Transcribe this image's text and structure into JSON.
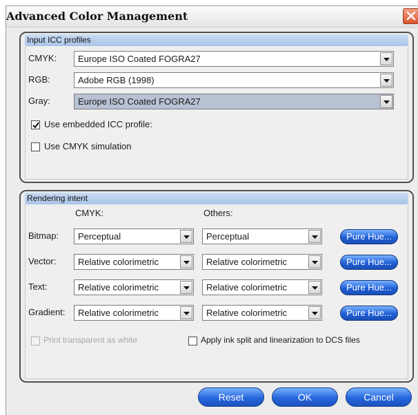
{
  "dialog": {
    "title": "Advanced Color Management"
  },
  "icons": {
    "close": "close-icon",
    "dropdown": "chevron-down-icon",
    "check": "checkmark-icon"
  },
  "colors": {
    "header_accent": "#b3cbeb",
    "button_blue": "#2566dc",
    "close_red": "#d9552f"
  },
  "input_profiles": {
    "header": "Input ICC profiles",
    "cmyk_label": "CMYK:",
    "cmyk_value": "Europe ISO Coated FOGRA27",
    "rgb_label": "RGB:",
    "rgb_value": "Adobe RGB (1998)",
    "gray_label": "Gray:",
    "gray_value": "Europe ISO Coated FOGRA27",
    "embedded_label": "Use embedded ICC profile:",
    "embedded_checked": true,
    "simulation_label": "Use CMYK simulation",
    "simulation_checked": false
  },
  "rendering": {
    "header": "Rendering intent",
    "col_cmyk": "CMYK:",
    "col_others": "Others:",
    "rows": [
      {
        "label": "Bitmap:",
        "cmyk": "Perceptual",
        "others": "Perceptual",
        "button": "Pure Hue..."
      },
      {
        "label": "Vector:",
        "cmyk": "Relative colorimetric",
        "others": "Relative colorimetric",
        "button": "Pure Hue..."
      },
      {
        "label": "Text:",
        "cmyk": "Relative colorimetric",
        "others": "Relative colorimetric",
        "button": "Pure Hue..."
      },
      {
        "label": "Gradient:",
        "cmyk": "Relative colorimetric",
        "others": "Relative colorimetric",
        "button": "Pure Hue..."
      }
    ],
    "transparent_label": "Print transparent as white",
    "transparent_checked": false,
    "transparent_enabled": false,
    "ink_split_label": "Apply ink split and linearization to DCS files",
    "ink_split_checked": false
  },
  "footer": {
    "reset": "Reset",
    "ok": "OK",
    "cancel": "Cancel"
  }
}
